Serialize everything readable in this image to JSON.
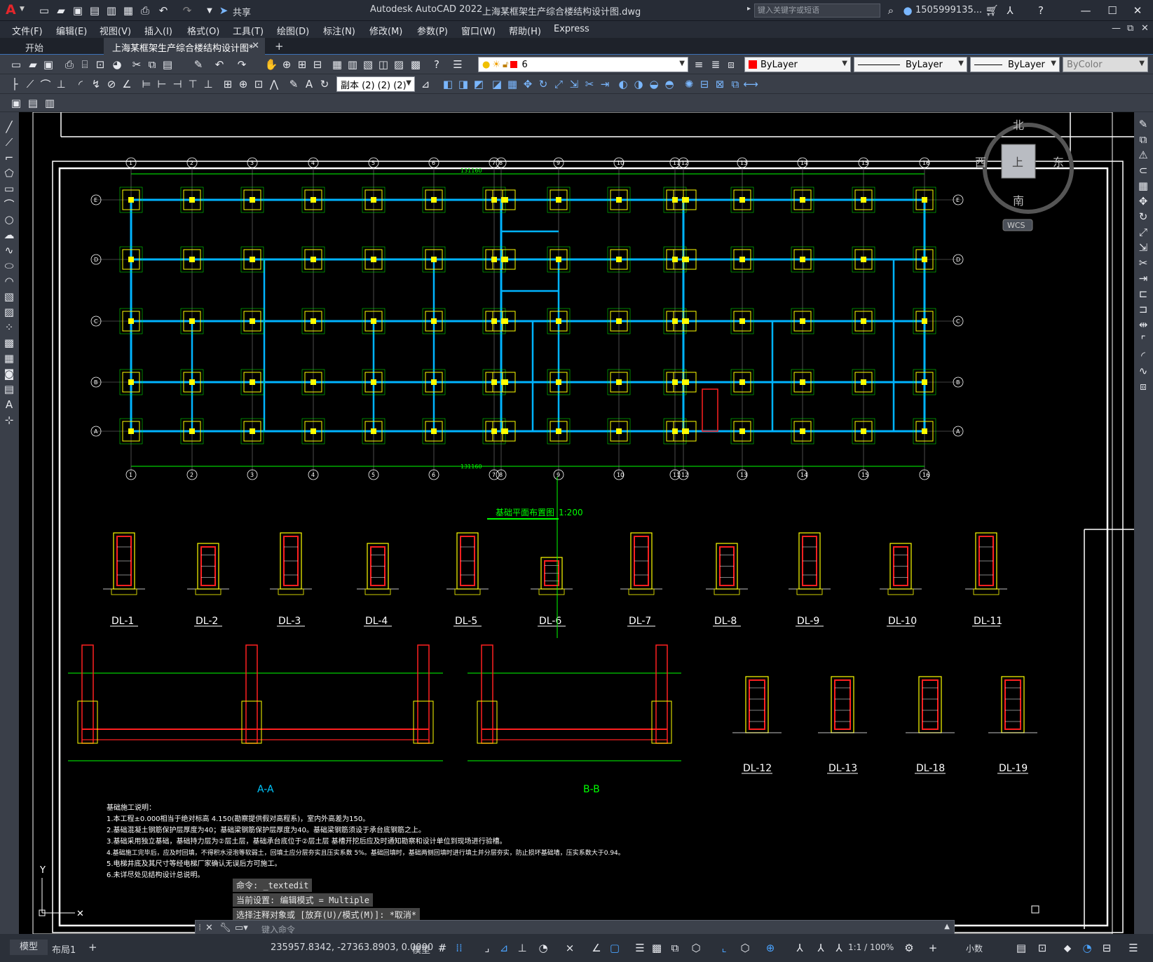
{
  "app": {
    "title": "Autodesk AutoCAD 2022",
    "file_title": "上海某框架生产综合楼结构设计图.dwg",
    "share_label": "共享",
    "search_placeholder": "键入关键字或短语",
    "user": "1505999135...",
    "logo": "A"
  },
  "menu": [
    "文件(F)",
    "编辑(E)",
    "视图(V)",
    "插入(I)",
    "格式(O)",
    "工具(T)",
    "绘图(D)",
    "标注(N)",
    "修改(M)",
    "参数(P)",
    "窗口(W)",
    "帮助(H)",
    "Express"
  ],
  "tabs": {
    "start": "开始",
    "active": "上海某框架生产综合楼结构设计图*",
    "new": "+"
  },
  "props": {
    "layer": "6",
    "color": "ByLayer",
    "linetype": "ByLayer",
    "lineweight": "ByLayer",
    "plotstyle": "ByColor",
    "dimstyle": "副本 (2) (2) (2)"
  },
  "viewcube": {
    "north": "北",
    "south": "南",
    "east": "东",
    "west": "西",
    "top": "上",
    "wcs": "WCS"
  },
  "drawing": {
    "plan_title": "基础平面布置图",
    "plan_scale": "1:200",
    "grid_cols": [
      "1",
      "2",
      "3",
      "4",
      "5",
      "6",
      "7",
      "8",
      "9",
      "10",
      "11",
      "12",
      "13",
      "14",
      "15",
      "16"
    ],
    "grid_rows": [
      "E",
      "D",
      "C",
      "B",
      "A"
    ],
    "total_length": "131160",
    "section_labels_row1": [
      "DL-1",
      "DL-2",
      "DL-3",
      "DL-4",
      "DL-5",
      "DL-6",
      "DL-7",
      "DL-8",
      "DL-9",
      "DL-10",
      "DL-11"
    ],
    "section_labels_row2": [
      "DL-12",
      "DL-13",
      "DL-18",
      "DL-19"
    ],
    "section_aa": "A-A",
    "section_bb": "B-B",
    "notes_title": "基础施工说明：",
    "notes": [
      "1.本工程±0.000相当于绝对标高 4.150(勘察提供假对高程系)，室内外高差为150。",
      "2.基础混凝土钢筋保护层厚度为40；基础梁钢筋保护层厚度为40。基础梁钢筋须设于承台底钢筋之上。",
      "3.基础采用独立基础，基础持力层为②层土层，基础承台底位于②层土层 基槽开挖后应及时通知勘察和设计单位到现场进行验槽。",
      "4.基础施工完毕后，应及时回填，不得积水浸泡等软弱土，回填土应分层夯实且压实系数 5%。基础回填时，基础两侧回填时进行填土并分层夯实，防止损坏基础墙，压实系数大于0.94。",
      "5.电梯井底及其尺寸等经电梯厂家确认无误后方可施工。",
      "6.未详尽处见结构设计总说明。"
    ]
  },
  "command": {
    "history": [
      "命令: _textedit",
      "当前设置: 编辑模式 = Multiple",
      "选择注释对象或 [放弃(U)/模式(M)]: *取消*"
    ],
    "placeholder": "键入命令"
  },
  "status": {
    "model_tab": "模型",
    "layout_tab": "布局1",
    "add": "+",
    "coords": "235957.8342, -27363.8903, 0.0000",
    "space": "模型",
    "scale": "1:1 / 100%",
    "units": "小数"
  },
  "colors": {
    "accent": "#3b71b8",
    "canvas": "#000000",
    "cyan": "#00c8ff",
    "yellow": "#ffff00",
    "green": "#00ff00",
    "red": "#ff2020"
  }
}
